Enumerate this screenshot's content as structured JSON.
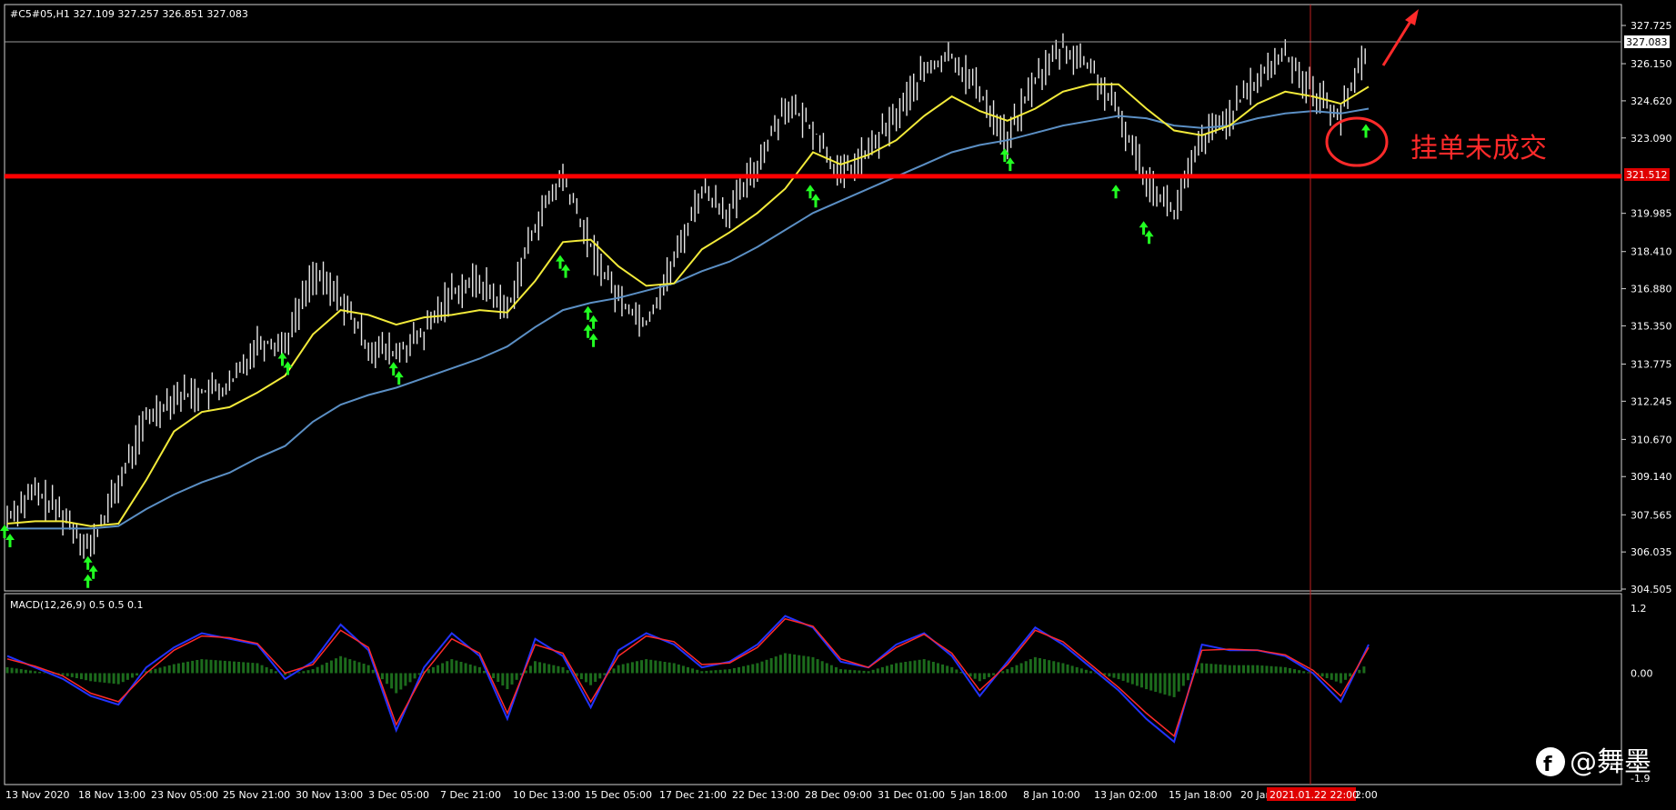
{
  "header": {
    "symbol_info": "#C5#05,H1  327.109 327.257 326.851 327.083"
  },
  "annotation": {
    "text": "挂单未成交"
  },
  "watermark": {
    "text": "@舞墨"
  },
  "current_price_label": "327.083",
  "level_label": "321.512",
  "crosshair_time_label": "2021.01.22 22:00",
  "colors": {
    "background": "#000000",
    "candles": "#e8e8e8",
    "ma_fast": "#f2ea3a",
    "ma_slow": "#5b8fc4",
    "horizontal_level": "#ff0000",
    "arrows": "#22ff22",
    "macd_line": "#2233ff",
    "signal_line": "#ff2a2a",
    "histogram": "#1c6b1c",
    "annotation": "#ff2a2a"
  },
  "chart_data": [
    {
      "type": "line",
      "title": "#C5#05,H1",
      "ylim": [
        304.505,
        327.725
      ],
      "y_ticks": [
        "327.725",
        "326.150",
        "324.620",
        "323.090",
        "321.512",
        "319.985",
        "318.410",
        "316.880",
        "315.350",
        "313.775",
        "312.245",
        "310.670",
        "309.140",
        "307.565",
        "306.035",
        "304.505"
      ],
      "x_ticks": [
        "13 Nov 2020",
        "18 Nov 13:00",
        "23 Nov 05:00",
        "25 Nov 21:00",
        "30 Nov 13:00",
        "3 Dec 05:00",
        "7 Dec 21:00",
        "10 Dec 13:00",
        "15 Dec 05:00",
        "17 Dec 21:00",
        "22 Dec 13:00",
        "28 Dec 09:00",
        "31 Dec 01:00",
        "5 Jan 18:00",
        "8 Jan 10:00",
        "13 Jan 02:00",
        "15 Jan 18:00",
        "20 Jan",
        "2:00"
      ],
      "series": [
        {
          "name": "price",
          "values": [
            307.5,
            308.5,
            307.6,
            306.2,
            308.8,
            311.5,
            312.5,
            312.6,
            312.8,
            314.7,
            314.6,
            317.5,
            316.5,
            314.5,
            314.2,
            315.0,
            316.8,
            317.2,
            316.0,
            319.5,
            321.5,
            318.6,
            316.5,
            315.5,
            318.0,
            321.0,
            320.0,
            322.0,
            324.5,
            323.5,
            321.5,
            322.5,
            324.0,
            325.8,
            326.5,
            325.0,
            323.0,
            325.5,
            326.8,
            326.0,
            324.0,
            321.5,
            320.0,
            323.0,
            324.0,
            325.5,
            326.6,
            325.0,
            324.0,
            327.083
          ]
        },
        {
          "values": [
            307.2,
            307.3,
            307.3,
            307.1,
            307.2,
            309.0,
            311.0,
            311.8,
            312.0,
            312.6,
            313.3,
            315.0,
            316.0,
            315.8,
            315.4,
            315.7,
            315.8,
            316.0,
            315.9,
            317.2,
            318.8,
            318.9,
            317.8,
            317.0,
            317.1,
            318.5,
            319.2,
            320.0,
            321.0,
            322.5,
            322.0,
            322.4,
            323.0,
            324.0,
            324.8,
            324.2,
            323.8,
            324.3,
            325.0,
            325.3,
            325.3,
            324.3,
            323.4,
            323.2,
            323.6,
            324.5,
            325.0,
            324.8,
            324.5,
            325.2
          ]
        },
        {
          "values": [
            307.0,
            307.0,
            307.0,
            307.0,
            307.1,
            307.8,
            308.4,
            308.9,
            309.3,
            309.9,
            310.4,
            311.4,
            312.1,
            312.5,
            312.8,
            313.2,
            313.6,
            314.0,
            314.5,
            315.3,
            316.0,
            316.3,
            316.5,
            316.8,
            317.1,
            317.6,
            318.0,
            318.6,
            319.3,
            320.0,
            320.5,
            321.0,
            321.5,
            322.0,
            322.5,
            322.8,
            323.0,
            323.3,
            323.6,
            323.8,
            324.0,
            323.9,
            323.6,
            323.5,
            323.6,
            323.9,
            324.1,
            324.2,
            324.1,
            324.3
          ]
        }
      ],
      "level": 321.512,
      "arrows_at_indices": [
        0,
        0,
        3,
        3,
        3,
        10,
        10,
        14,
        14,
        20,
        20,
        21,
        21,
        21,
        21,
        29,
        29,
        36,
        36,
        40,
        41,
        41,
        49
      ]
    },
    {
      "type": "line",
      "title": "MACD(12,26,9) 0.5 0.5 0.1",
      "ylim": [
        -1.9,
        1.2
      ],
      "y_ticks": [
        "1.2",
        "0.00",
        "-1.9"
      ],
      "series": [
        {
          "values": [
            0.3,
            0.1,
            -0.1,
            -0.4,
            -0.55,
            0.1,
            0.45,
            0.7,
            0.6,
            0.5,
            -0.1,
            0.2,
            0.85,
            0.4,
            -1.0,
            0.1,
            0.7,
            0.3,
            -0.8,
            0.6,
            0.3,
            -0.6,
            0.4,
            0.7,
            0.5,
            0.1,
            0.2,
            0.5,
            1.0,
            0.8,
            0.2,
            0.1,
            0.5,
            0.7,
            0.3,
            -0.4,
            0.2,
            0.8,
            0.5,
            0.1,
            -0.3,
            -0.8,
            -1.2,
            0.5,
            0.4,
            0.4,
            0.3,
            0.0,
            -0.5,
            0.5
          ]
        },
        {
          "values": [
            0.25,
            0.12,
            -0.05,
            -0.35,
            -0.5,
            0.0,
            0.4,
            0.65,
            0.62,
            0.52,
            0.0,
            0.15,
            0.75,
            0.45,
            -0.9,
            0.0,
            0.6,
            0.35,
            -0.7,
            0.5,
            0.35,
            -0.5,
            0.3,
            0.65,
            0.55,
            0.15,
            0.18,
            0.45,
            0.95,
            0.82,
            0.25,
            0.1,
            0.45,
            0.68,
            0.35,
            -0.3,
            0.15,
            0.75,
            0.55,
            0.15,
            -0.25,
            -0.7,
            -1.1,
            0.4,
            0.42,
            0.4,
            0.32,
            0.05,
            -0.4,
            0.45
          ]
        }
      ]
    }
  ]
}
